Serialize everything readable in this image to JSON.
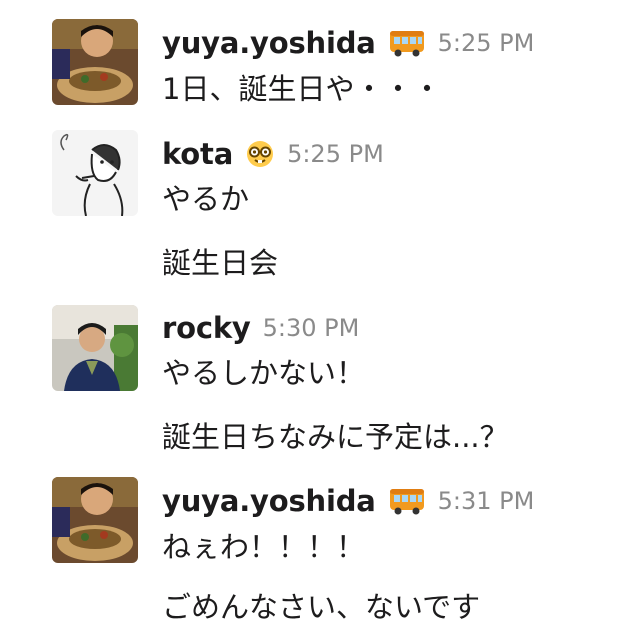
{
  "colors": {
    "text": "#1d1c1d",
    "timestamp": "#8a8a8a",
    "background": "#ffffff"
  },
  "messages": [
    {
      "user": "yuya.yoshida",
      "status_icon": "bus-icon",
      "time": "5:25 PM",
      "lines": [
        "1日、誕生日や・・・"
      ]
    },
    {
      "user": "kota",
      "status_icon": "nerd-face-icon",
      "time": "5:25 PM",
      "lines": [
        "やるか",
        "誕生日会"
      ]
    },
    {
      "user": "rocky",
      "time": "5:30 PM",
      "lines": [
        "やるしかない！",
        "誕生日ちなみに予定は...？"
      ]
    },
    {
      "user": "yuya.yoshida",
      "status_icon": "bus-icon",
      "time": "5:31 PM",
      "lines": [
        "ねぇわ！！！！",
        "ごめんなさい、ないです"
      ]
    }
  ]
}
